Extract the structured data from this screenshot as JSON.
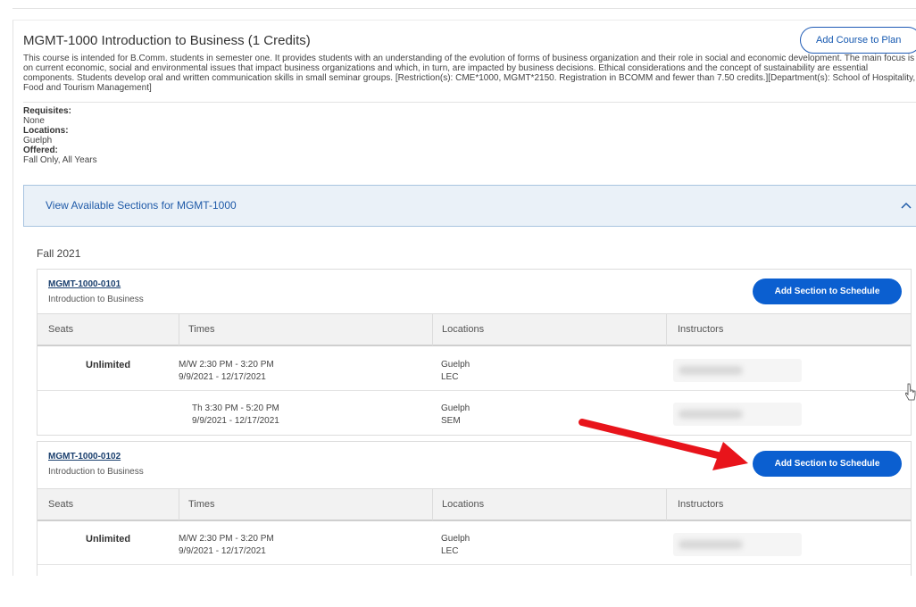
{
  "course": {
    "title": "MGMT-1000 Introduction to Business (1 Credits)",
    "add_button": "Add Course to Plan",
    "description": "This course is intended for B.Comm. students in semester one. It provides students with an understanding of the evolution of forms of business organization and their role in social and economic development. The main focus is on current economic, social and environmental issues that impact business organizations and which, in turn, are impacted by business decisions. Ethical considerations and the concept of sustainability are essential components. Students develop oral and written communication skills in small seminar groups. [Restriction(s): CME*1000, MGMT*2150. Registration in BCOMM and fewer than 7.50 credits.][Department(s): School of Hospitality, Food and Tourism Management]",
    "requisites_label": "Requisites:",
    "requisites": "None",
    "locations_label": "Locations:",
    "locations": "Guelph",
    "offered_label": "Offered:",
    "offered": "Fall Only, All Years"
  },
  "sections_panel": {
    "title": "View Available Sections for MGMT-1000",
    "chevron": "chevron-up-icon",
    "term": "Fall 2021"
  },
  "table_headers": [
    "Seats",
    "Times",
    "Locations",
    "Instructors"
  ],
  "sections": [
    {
      "code": "MGMT-1000-0101",
      "name": "Introduction to Business",
      "button": "Add Section to Schedule",
      "rows": [
        {
          "seats": "Unlimited",
          "time": "M/W 2:30 PM - 3:20 PM",
          "dates": "9/9/2021 - 12/17/2021",
          "location": "Guelph",
          "type": "LEC"
        },
        {
          "seats": "",
          "time": "Th 3:30 PM - 5:20 PM",
          "dates": "9/9/2021 - 12/17/2021",
          "location": "Guelph",
          "type": "SEM"
        }
      ]
    },
    {
      "code": "MGMT-1000-0102",
      "name": "Introduction to Business",
      "button": "Add Section to Schedule",
      "rows": [
        {
          "seats": "Unlimited",
          "time": "M/W 2:30 PM - 3:20 PM",
          "dates": "9/9/2021 - 12/17/2021",
          "location": "Guelph",
          "type": "LEC"
        }
      ]
    }
  ],
  "colors": {
    "primary_button": "#0b5fd0",
    "link": "#1f5aa8",
    "annotation_arrow": "#e8141b"
  }
}
